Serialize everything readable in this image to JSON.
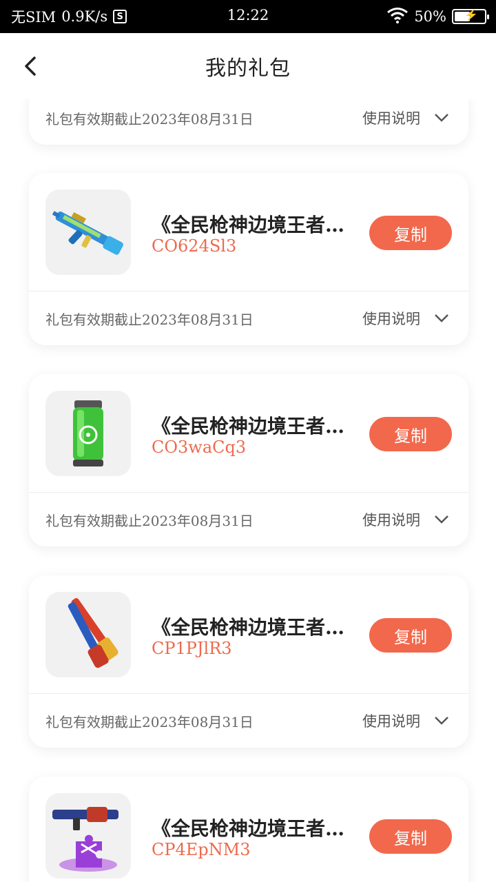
{
  "status_bar": {
    "carrier": "无SIM",
    "speed": "0.9K/s",
    "s_icon": "S",
    "time": "12:22",
    "battery": "50%"
  },
  "nav": {
    "title": "我的礼包"
  },
  "labels": {
    "help": "使用说明",
    "copy": "复制"
  },
  "partial_card": {
    "validity": "礼包有效期截止2023年08月31日"
  },
  "gifts": [
    {
      "title": "《全民枪神边境王者》礼包",
      "code": "CO624Sl3",
      "validity": "礼包有效期截止2023年08月31日",
      "icon": "blue-rifle-icon"
    },
    {
      "title": "《全民枪神边境王者》礼包",
      "code": "CO3waCq3",
      "validity": "礼包有效期截止2023年08月31日",
      "icon": "green-biohazard-canister-icon"
    },
    {
      "title": "《全民枪神边境王者》礼包",
      "code": "CP1PJlR3",
      "validity": "礼包有效期截止2023年08月31日",
      "icon": "dual-shotguns-icon"
    },
    {
      "title": "《全民枪神边境王者》礼包",
      "code": "CP4EpNM3",
      "validity": "",
      "icon": "smg-puzzle-icon"
    }
  ]
}
